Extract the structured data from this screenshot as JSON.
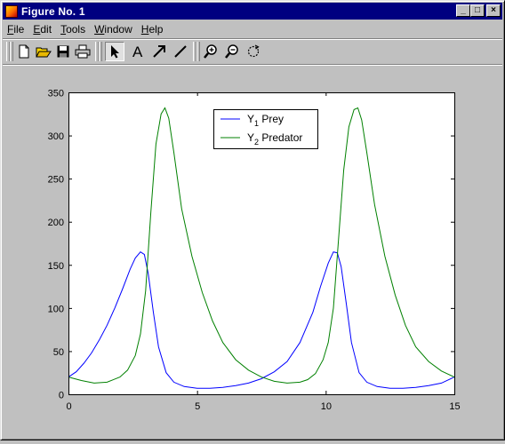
{
  "window": {
    "title": "Figure No. 1",
    "minimize_label": "_",
    "maximize_label": "□",
    "close_label": "×"
  },
  "menu": [
    {
      "pre": "",
      "u": "F",
      "post": "ile"
    },
    {
      "pre": "",
      "u": "E",
      "post": "dit"
    },
    {
      "pre": "",
      "u": "T",
      "post": "ools"
    },
    {
      "pre": "",
      "u": "W",
      "post": "indow"
    },
    {
      "pre": "",
      "u": "H",
      "post": "elp"
    }
  ],
  "toolbar": {
    "icons": [
      "new-file-icon",
      "open-folder-icon",
      "save-icon",
      "print-icon",
      "select-arrow-icon",
      "insert-text-icon",
      "insert-arrow-icon",
      "insert-line-icon",
      "zoom-in-icon",
      "zoom-out-icon",
      "rotate-icon"
    ],
    "text_tool_glyph": "A"
  },
  "chart_data": {
    "type": "line",
    "xlim": [
      0,
      15
    ],
    "ylim": [
      0,
      350
    ],
    "xticks": [
      0,
      5,
      10,
      15
    ],
    "yticks": [
      0,
      50,
      100,
      150,
      200,
      250,
      300,
      350
    ],
    "legend": {
      "placement": "top-center",
      "entries": [
        {
          "name": "Y",
          "sub": "1",
          "suffix": " Prey",
          "color": "#0000ff"
        },
        {
          "name": "Y",
          "sub": "2",
          "suffix": " Predator",
          "color": "#008000"
        }
      ]
    },
    "series": [
      {
        "name": "Y1 Prey",
        "color": "#0000ff",
        "x": [
          0,
          0.3,
          0.6,
          0.9,
          1.2,
          1.5,
          1.8,
          2.1,
          2.4,
          2.6,
          2.8,
          2.95,
          3.1,
          3.3,
          3.5,
          3.8,
          4.1,
          4.5,
          5,
          5.5,
          6,
          6.5,
          7,
          7.5,
          8,
          8.5,
          9,
          9.5,
          9.8,
          10.1,
          10.3,
          10.45,
          10.6,
          10.8,
          11,
          11.3,
          11.6,
          12,
          12.5,
          13,
          13.5,
          14,
          14.5,
          15
        ],
        "y": [
          20,
          26,
          36,
          48,
          63,
          80,
          100,
          122,
          145,
          158,
          165,
          162,
          140,
          95,
          55,
          25,
          14,
          9,
          7,
          7,
          8,
          10,
          13,
          18,
          26,
          38,
          60,
          95,
          125,
          152,
          165,
          164,
          148,
          105,
          60,
          25,
          14,
          9,
          7,
          7,
          8,
          10,
          13,
          20
        ]
      },
      {
        "name": "Y2 Predator",
        "color": "#008000",
        "x": [
          0,
          0.5,
          1,
          1.5,
          2,
          2.3,
          2.6,
          2.8,
          3,
          3.2,
          3.4,
          3.6,
          3.75,
          3.9,
          4.1,
          4.4,
          4.8,
          5.2,
          5.6,
          6,
          6.5,
          7,
          7.5,
          8,
          8.5,
          9,
          9.3,
          9.6,
          9.9,
          10.1,
          10.3,
          10.5,
          10.7,
          10.9,
          11.1,
          11.25,
          11.4,
          11.6,
          11.9,
          12.3,
          12.7,
          13.1,
          13.5,
          14,
          14.5,
          15
        ],
        "y": [
          20,
          16,
          13,
          14,
          20,
          28,
          45,
          70,
          120,
          210,
          290,
          325,
          332,
          320,
          280,
          215,
          160,
          118,
          85,
          60,
          40,
          28,
          20,
          15,
          13,
          14,
          17,
          24,
          40,
          60,
          100,
          180,
          260,
          310,
          330,
          332,
          318,
          280,
          220,
          160,
          115,
          80,
          55,
          38,
          27,
          20
        ]
      }
    ]
  }
}
